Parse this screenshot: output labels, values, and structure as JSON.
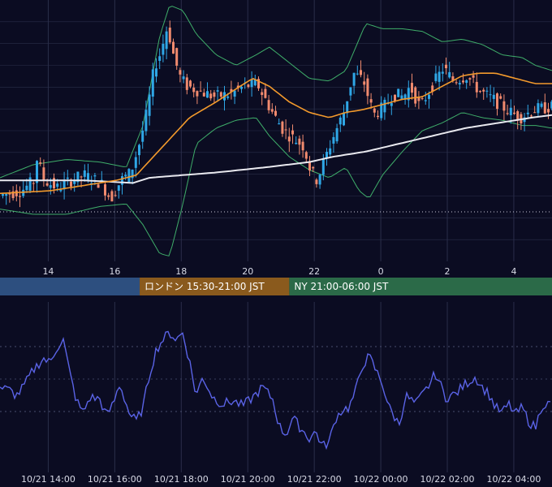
{
  "chart_data": {
    "type": "candlestick",
    "colors": {
      "background": "#0b0c22",
      "grid": "#2a2e4a",
      "up": "#2fa7e6",
      "down": "#f08a6e",
      "bollinger": "#3fae6a",
      "ma_short": "#f39a2c",
      "ma_long": "#e9e9ef",
      "oscillator": "#5a63e6",
      "session_asia": "#2d4f7f",
      "session_london": "#8a5a1d",
      "session_ny": "#2b6a48"
    },
    "x_ticks": [
      "14",
      "16",
      "18",
      "20",
      "22",
      "0",
      "2",
      "4"
    ],
    "bottom_ticks": [
      "10/21 14:00",
      "10/21 16:00",
      "10/21 18:00",
      "10/21 20:00",
      "10/21 22:00",
      "10/22 00:00",
      "10/22 02:00",
      "10/22 04:00"
    ],
    "x_range": [
      12.5,
      29.1
    ],
    "price_range": [
      0,
      100
    ],
    "sessions": [
      {
        "label": "",
        "start": 12.5,
        "end": 16.7,
        "color": "session_asia"
      },
      {
        "label": "ロンドン 15:30-21:00 JST",
        "start": 16.7,
        "end": 21.2,
        "color": "session_london"
      },
      {
        "label": "NY 21:00-06:00 JST",
        "start": 21.2,
        "end": 29.1,
        "color": "session_ny"
      }
    ],
    "price_anchors": [
      [
        12.5,
        25
      ],
      [
        13.2,
        27
      ],
      [
        13.6,
        31
      ],
      [
        13.6,
        42
      ],
      [
        13.9,
        31
      ],
      [
        14.3,
        28
      ],
      [
        14.7,
        31
      ],
      [
        15.1,
        33
      ],
      [
        15.6,
        30
      ],
      [
        15.9,
        24
      ],
      [
        16.2,
        31
      ],
      [
        16.5,
        34
      ],
      [
        16.8,
        47
      ],
      [
        17.0,
        58
      ],
      [
        17.2,
        74
      ],
      [
        17.4,
        80
      ],
      [
        17.6,
        90
      ],
      [
        17.8,
        78
      ],
      [
        18.0,
        70
      ],
      [
        18.2,
        67
      ],
      [
        18.6,
        65
      ],
      [
        19.0,
        63
      ],
      [
        19.5,
        64
      ],
      [
        19.9,
        67
      ],
      [
        20.3,
        68
      ],
      [
        20.5,
        63
      ],
      [
        20.8,
        56
      ],
      [
        21.1,
        50
      ],
      [
        21.4,
        47
      ],
      [
        21.7,
        44
      ],
      [
        21.9,
        35
      ],
      [
        22.1,
        31
      ],
      [
        22.3,
        38
      ],
      [
        22.6,
        48
      ],
      [
        22.9,
        57
      ],
      [
        23.2,
        72
      ],
      [
        23.5,
        69
      ],
      [
        23.8,
        56
      ],
      [
        24.1,
        59
      ],
      [
        24.4,
        64
      ],
      [
        24.7,
        63
      ],
      [
        24.9,
        67
      ],
      [
        25.2,
        59
      ],
      [
        25.6,
        68
      ],
      [
        25.9,
        74
      ],
      [
        26.2,
        69
      ],
      [
        26.6,
        71
      ],
      [
        27.0,
        65
      ],
      [
        27.4,
        62
      ],
      [
        27.8,
        58
      ],
      [
        28.2,
        55
      ],
      [
        28.6,
        58
      ],
      [
        29.1,
        59
      ]
    ],
    "ma_long_anchors": [
      [
        12.5,
        31
      ],
      [
        15.0,
        31
      ],
      [
        16.5,
        30
      ],
      [
        17.0,
        32
      ],
      [
        18.0,
        33
      ],
      [
        19.0,
        34
      ],
      [
        20.5,
        36
      ],
      [
        21.8,
        38
      ],
      [
        22.5,
        40
      ],
      [
        23.5,
        42
      ],
      [
        24.5,
        45
      ],
      [
        25.5,
        48
      ],
      [
        26.5,
        51
      ],
      [
        27.5,
        53
      ],
      [
        28.5,
        55
      ],
      [
        29.1,
        56
      ]
    ],
    "ma_short_anchors": [
      [
        12.5,
        26
      ],
      [
        14.0,
        27
      ],
      [
        15.0,
        29
      ],
      [
        16.0,
        31
      ],
      [
        16.6,
        33
      ],
      [
        17.4,
        44
      ],
      [
        18.2,
        55
      ],
      [
        19.0,
        61
      ],
      [
        19.6,
        66
      ],
      [
        20.1,
        70
      ],
      [
        20.6,
        67
      ],
      [
        21.2,
        61
      ],
      [
        21.8,
        57
      ],
      [
        22.4,
        55
      ],
      [
        22.9,
        57
      ],
      [
        23.4,
        58
      ],
      [
        24.0,
        60
      ],
      [
        24.6,
        62
      ],
      [
        25.2,
        63
      ],
      [
        25.8,
        67
      ],
      [
        26.4,
        71
      ],
      [
        26.9,
        72
      ],
      [
        27.4,
        72
      ],
      [
        28.0,
        70
      ],
      [
        28.6,
        68
      ],
      [
        29.1,
        68
      ]
    ],
    "bb_upper_anchors": [
      [
        12.5,
        32
      ],
      [
        13.5,
        37
      ],
      [
        14.5,
        39
      ],
      [
        15.5,
        38
      ],
      [
        16.3,
        36
      ],
      [
        16.8,
        52
      ],
      [
        17.3,
        86
      ],
      [
        17.6,
        98
      ],
      [
        18.0,
        96
      ],
      [
        18.4,
        87
      ],
      [
        19.0,
        79
      ],
      [
        19.6,
        75
      ],
      [
        20.2,
        79
      ],
      [
        20.6,
        82
      ],
      [
        21.2,
        76
      ],
      [
        21.8,
        70
      ],
      [
        22.4,
        69
      ],
      [
        22.9,
        73
      ],
      [
        23.5,
        91
      ],
      [
        24.0,
        89
      ],
      [
        24.6,
        89
      ],
      [
        25.2,
        88
      ],
      [
        25.8,
        84
      ],
      [
        26.4,
        85
      ],
      [
        27.0,
        83
      ],
      [
        27.6,
        79
      ],
      [
        28.2,
        78
      ],
      [
        28.6,
        75
      ],
      [
        29.1,
        73
      ]
    ],
    "bb_lower_anchors": [
      [
        12.5,
        20
      ],
      [
        13.5,
        18
      ],
      [
        14.5,
        18
      ],
      [
        15.5,
        21
      ],
      [
        16.3,
        22
      ],
      [
        16.8,
        14
      ],
      [
        17.3,
        3
      ],
      [
        17.6,
        2
      ],
      [
        18.0,
        22
      ],
      [
        18.4,
        45
      ],
      [
        19.0,
        51
      ],
      [
        19.6,
        54
      ],
      [
        20.2,
        55
      ],
      [
        20.6,
        48
      ],
      [
        21.2,
        40
      ],
      [
        21.8,
        35
      ],
      [
        22.4,
        32
      ],
      [
        22.9,
        36
      ],
      [
        23.3,
        27
      ],
      [
        23.6,
        24
      ],
      [
        24.0,
        33
      ],
      [
        24.6,
        42
      ],
      [
        25.2,
        50
      ],
      [
        25.8,
        53
      ],
      [
        26.4,
        57
      ],
      [
        27.0,
        55
      ],
      [
        27.6,
        54
      ],
      [
        28.2,
        52
      ],
      [
        28.6,
        52
      ],
      [
        29.1,
        51
      ]
    ],
    "osc_range": [
      0,
      100
    ],
    "osc_anchors": [
      [
        12.5,
        50
      ],
      [
        12.8,
        48
      ],
      [
        13.0,
        45
      ],
      [
        13.2,
        50
      ],
      [
        13.5,
        60
      ],
      [
        13.8,
        67
      ],
      [
        14.0,
        64
      ],
      [
        14.2,
        73
      ],
      [
        14.4,
        78
      ],
      [
        14.6,
        58
      ],
      [
        14.8,
        42
      ],
      [
        15.0,
        35
      ],
      [
        15.2,
        44
      ],
      [
        15.5,
        43
      ],
      [
        15.7,
        33
      ],
      [
        15.9,
        40
      ],
      [
        16.1,
        52
      ],
      [
        16.4,
        34
      ],
      [
        16.6,
        30
      ],
      [
        16.8,
        38
      ],
      [
        17.0,
        58
      ],
      [
        17.2,
        72
      ],
      [
        17.4,
        78
      ],
      [
        17.6,
        82
      ],
      [
        17.8,
        78
      ],
      [
        18.0,
        82
      ],
      [
        18.2,
        65
      ],
      [
        18.4,
        45
      ],
      [
        18.6,
        56
      ],
      [
        18.9,
        44
      ],
      [
        19.2,
        40
      ],
      [
        19.5,
        42
      ],
      [
        19.8,
        39
      ],
      [
        20.1,
        44
      ],
      [
        20.4,
        50
      ],
      [
        20.7,
        43
      ],
      [
        20.9,
        27
      ],
      [
        21.1,
        22
      ],
      [
        21.3,
        32
      ],
      [
        21.5,
        27
      ],
      [
        21.8,
        20
      ],
      [
        22.0,
        24
      ],
      [
        22.2,
        15
      ],
      [
        22.4,
        18
      ],
      [
        22.6,
        32
      ],
      [
        22.8,
        37
      ],
      [
        23.0,
        38
      ],
      [
        23.2,
        48
      ],
      [
        23.4,
        63
      ],
      [
        23.6,
        68
      ],
      [
        23.8,
        60
      ],
      [
        24.0,
        52
      ],
      [
        24.2,
        38
      ],
      [
        24.5,
        28
      ],
      [
        24.7,
        45
      ],
      [
        25.0,
        40
      ],
      [
        25.3,
        48
      ],
      [
        25.6,
        58
      ],
      [
        25.9,
        44
      ],
      [
        26.2,
        46
      ],
      [
        26.5,
        52
      ],
      [
        26.8,
        56
      ],
      [
        27.0,
        50
      ],
      [
        27.2,
        46
      ],
      [
        27.4,
        38
      ],
      [
        27.6,
        35
      ],
      [
        27.8,
        40
      ],
      [
        28.0,
        34
      ],
      [
        28.2,
        38
      ],
      [
        28.4,
        30
      ],
      [
        28.6,
        26
      ],
      [
        28.8,
        40
      ],
      [
        29.1,
        40
      ]
    ]
  }
}
